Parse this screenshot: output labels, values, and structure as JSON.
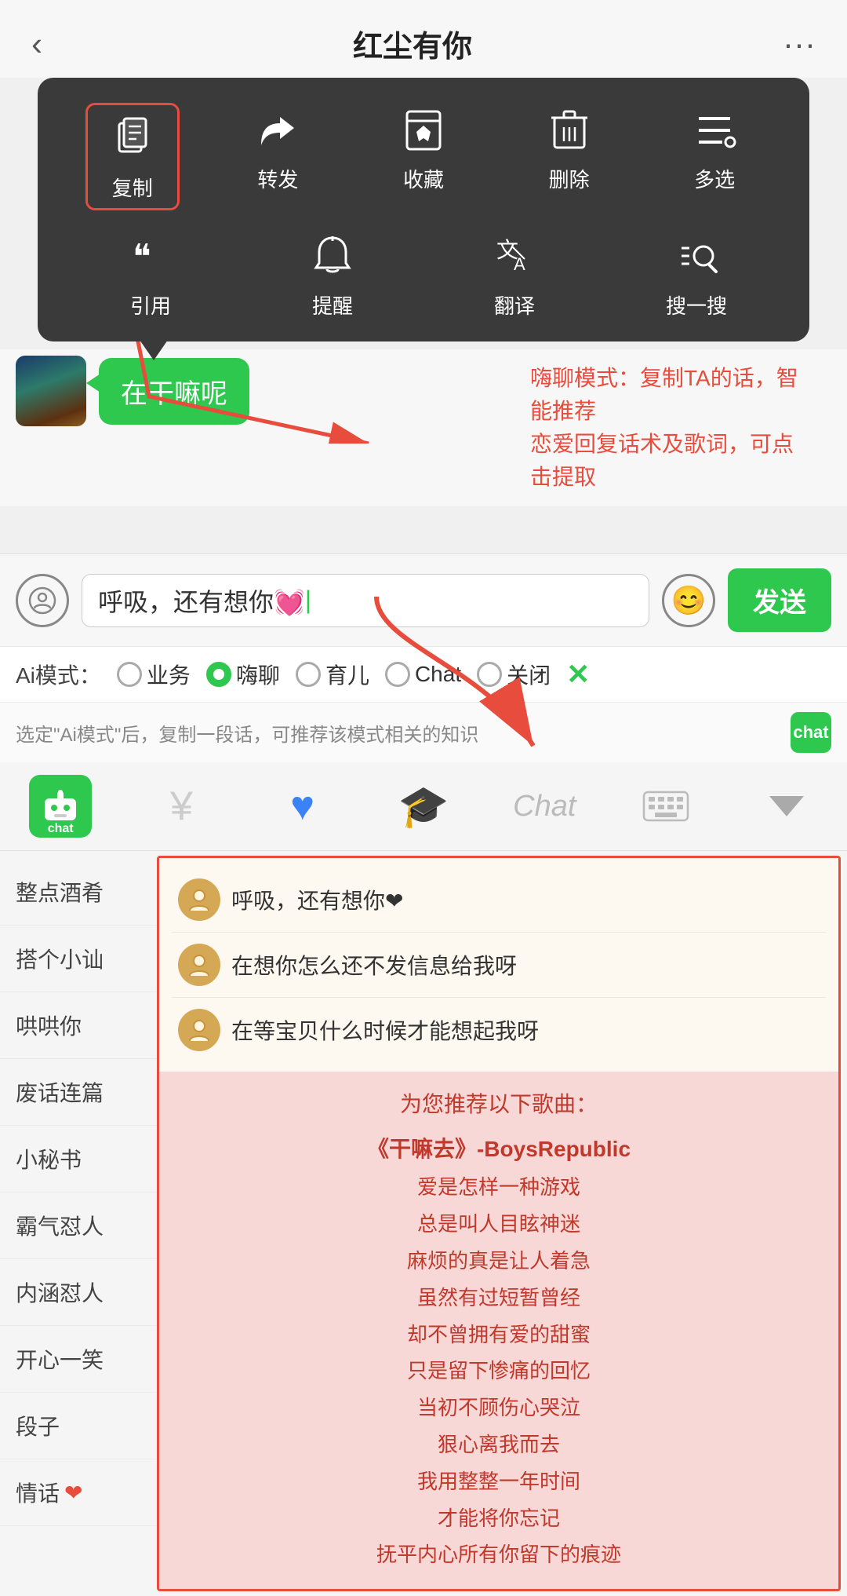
{
  "app": {
    "title": "红尘有你",
    "back_icon": "‹",
    "more_icon": "···"
  },
  "context_menu": {
    "row1": [
      {
        "icon": "copy",
        "label": "复制",
        "highlighted": true
      },
      {
        "icon": "forward",
        "label": "转发"
      },
      {
        "icon": "collect",
        "label": "收藏"
      },
      {
        "icon": "delete",
        "label": "删除"
      },
      {
        "icon": "multi",
        "label": "多选"
      }
    ],
    "row2": [
      {
        "icon": "quote",
        "label": "引用"
      },
      {
        "icon": "remind",
        "label": "提醒"
      },
      {
        "icon": "translate",
        "label": "翻译"
      },
      {
        "icon": "search",
        "label": "搜一搜"
      }
    ]
  },
  "chat": {
    "message": "在干嘛呢",
    "annotation": "嗨聊模式：复制TA的话，智能推荐\n恋爱回复话术及歌词，可点击提取"
  },
  "input": {
    "value": "呼吸，还有想你💓",
    "send_label": "发送"
  },
  "ai_modes": {
    "label": "Ai模式：",
    "options": [
      {
        "id": "business",
        "label": "业务",
        "active": false
      },
      {
        "id": "haichat",
        "label": "嗨聊",
        "active": true
      },
      {
        "id": "child",
        "label": "育儿",
        "active": false
      },
      {
        "id": "chat",
        "label": "Chat",
        "active": false
      },
      {
        "id": "off",
        "label": "关闭",
        "active": false
      }
    ],
    "close_icon": "✕"
  },
  "hint": {
    "text": "选定\"Ai模式\"后，复制一段话，可推荐该模式相关的知识"
  },
  "toolbar": {
    "items": [
      {
        "id": "robot",
        "label": "chat",
        "type": "robot"
      },
      {
        "id": "yen",
        "label": "¥",
        "type": "yen"
      },
      {
        "id": "heart",
        "label": "♥",
        "type": "heart"
      },
      {
        "id": "grad",
        "label": "🎓",
        "type": "grad"
      },
      {
        "id": "chat-text",
        "label": "Chat",
        "type": "chat-text"
      },
      {
        "id": "keyboard",
        "label": "⌨",
        "type": "keyboard"
      },
      {
        "id": "arrow-down",
        "label": "▼",
        "type": "arrow"
      }
    ]
  },
  "sidebar": {
    "items": [
      {
        "label": "整点酒肴"
      },
      {
        "label": "搭个小讪"
      },
      {
        "label": "哄哄你"
      },
      {
        "label": "废话连篇"
      },
      {
        "label": "小秘书"
      },
      {
        "label": "霸气怼人"
      },
      {
        "label": "内涵怼人"
      },
      {
        "label": "开心一笑"
      },
      {
        "label": "段子"
      },
      {
        "label": "情话",
        "heart": true
      }
    ]
  },
  "replies": [
    {
      "text": "呼吸，还有想你❤"
    },
    {
      "text": "在想你怎么还不发信息给我呀"
    },
    {
      "text": "在等宝贝什么时候才能想起我呀"
    }
  ],
  "songs": {
    "header": "为您推荐以下歌曲：",
    "items": [
      {
        "text": "《干嘛去》-BoysRepublic",
        "bold": true
      },
      {
        "text": "爱是怎样一种游戏"
      },
      {
        "text": "总是叫人目眩神迷"
      },
      {
        "text": "麻烦的真是让人着急"
      },
      {
        "text": "虽然有过短暂曾经"
      },
      {
        "text": "却不曾拥有爱的甜蜜"
      },
      {
        "text": "只是留下惨痛的回忆"
      },
      {
        "text": "当初不顾伤心哭泣"
      },
      {
        "text": "狠心离我而去"
      },
      {
        "text": "我用整整一年时间"
      },
      {
        "text": "才能将你忘记"
      },
      {
        "text": "抚平内心所有你留下的痕迹"
      }
    ]
  }
}
